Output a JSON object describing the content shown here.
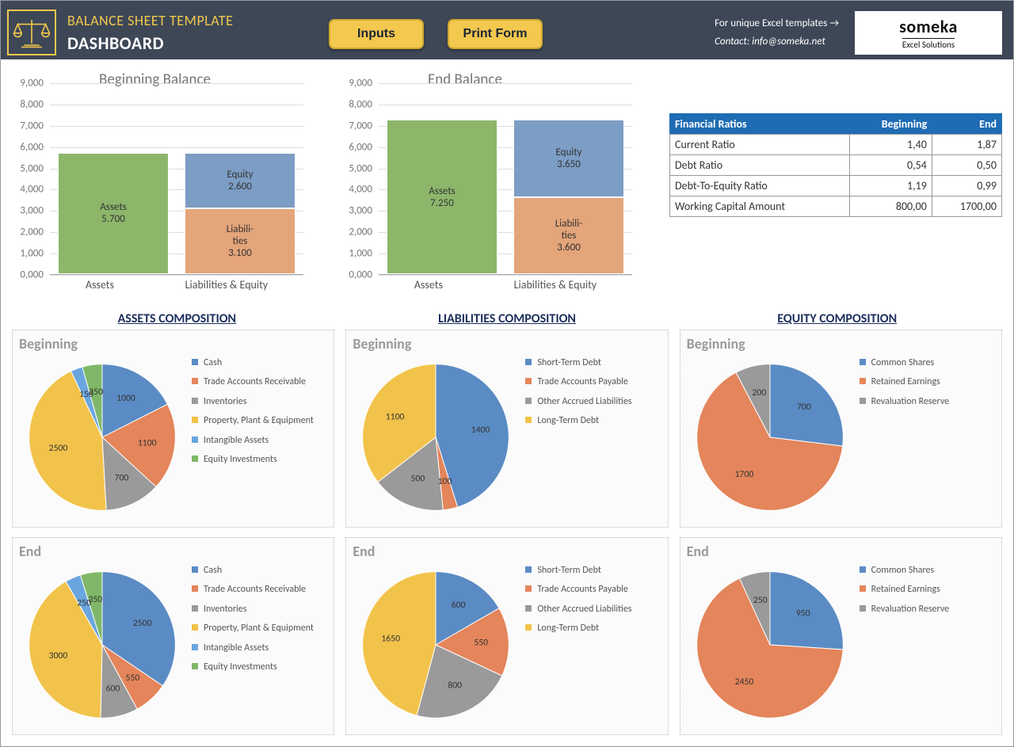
{
  "header": {
    "title": "BALANCE SHEET TEMPLATE",
    "subtitle": "DASHBOARD",
    "btn_inputs": "Inputs",
    "btn_print": "Print Form",
    "link1": "For unique Excel templates →",
    "link2": "Contact: info@someka.net",
    "logo_top": "someka",
    "logo_bottom": "Excel Solutions"
  },
  "barcharts": {
    "beginning_title": "Beginning Balance",
    "end_title": "End Balance",
    "x1": "Assets",
    "x2": "Liabilities & Equity"
  },
  "ratios": {
    "h1": "Financial Ratios",
    "h2": "Beginning",
    "h3": "End",
    "rows": [
      {
        "n": "Current Ratio",
        "b": "1,40",
        "e": "1,87"
      },
      {
        "n": "Debt Ratio",
        "b": "0,54",
        "e": "0,50"
      },
      {
        "n": "Debt-To-Equity Ratio",
        "b": "1,19",
        "e": "0,99"
      },
      {
        "n": "Working Capital Amount",
        "b": "800,00",
        "e": "1700,00"
      }
    ]
  },
  "sections": {
    "assets": "ASSETS COMPOSITION",
    "liab": "LIABILITIES COMPOSITION",
    "equity": "EQUITY COMPOSITION"
  },
  "periods": {
    "beg": "Beginning",
    "end": "End"
  },
  "legends": {
    "assets": [
      "Cash",
      "Trade Accounts Receivable",
      "Inventories",
      "Property, Plant & Equipment",
      "Intangible Assets",
      "Equity Investments"
    ],
    "liab": [
      "Short-Term Debt",
      "Trade Accounts Payable",
      "Other Accrued Liabilities",
      "Long-Term Debt"
    ],
    "equity": [
      "Common Shares",
      "Retained Earnings",
      "Revaluation Reserve"
    ]
  },
  "chart_data": [
    {
      "id": "bar_beginning",
      "type": "bar",
      "title": "Beginning Balance",
      "categories": [
        "Assets",
        "Liabilities & Equity"
      ],
      "series": [
        {
          "name": "Assets",
          "values": [
            5700,
            0
          ]
        },
        {
          "name": "Liabilities",
          "values": [
            0,
            3100
          ]
        },
        {
          "name": "Equity",
          "values": [
            0,
            2600
          ]
        }
      ],
      "ylim": [
        0,
        9000
      ],
      "ytick": 1000
    },
    {
      "id": "bar_end",
      "type": "bar",
      "title": "End Balance",
      "categories": [
        "Assets",
        "Liabilities & Equity"
      ],
      "series": [
        {
          "name": "Assets",
          "values": [
            7250,
            0
          ]
        },
        {
          "name": "Liabilities",
          "values": [
            0,
            3600
          ]
        },
        {
          "name": "Equity",
          "values": [
            0,
            3650
          ]
        }
      ],
      "ylim": [
        0,
        9000
      ],
      "ytick": 1000
    },
    {
      "id": "pie_assets_beg",
      "type": "pie",
      "title": "Assets Composition – Beginning",
      "labels": [
        "Cash",
        "Trade Accounts Receivable",
        "Inventories",
        "Property, Plant & Equipment",
        "Intangible Assets",
        "Equity Investments"
      ],
      "values": [
        1000,
        1100,
        700,
        2500,
        150,
        250
      ]
    },
    {
      "id": "pie_assets_end",
      "type": "pie",
      "title": "Assets Composition – End",
      "labels": [
        "Cash",
        "Trade Accounts Receivable",
        "Inventories",
        "Property, Plant & Equipment",
        "Intangible Assets",
        "Equity Investments"
      ],
      "values": [
        2500,
        550,
        600,
        3000,
        250,
        350
      ]
    },
    {
      "id": "pie_liab_beg",
      "type": "pie",
      "title": "Liabilities Composition – Beginning",
      "labels": [
        "Short-Term Debt",
        "Trade Accounts Payable",
        "Other Accrued Liabilities",
        "Long-Term Debt"
      ],
      "values": [
        1400,
        100,
        500,
        1100
      ]
    },
    {
      "id": "pie_liab_end",
      "type": "pie",
      "title": "Liabilities Composition – End",
      "labels": [
        "Short-Term Debt",
        "Trade Accounts Payable",
        "Other Accrued Liabilities",
        "Long-Term Debt"
      ],
      "values": [
        600,
        550,
        800,
        1650
      ]
    },
    {
      "id": "pie_equity_beg",
      "type": "pie",
      "title": "Equity Composition – Beginning",
      "labels": [
        "Common Shares",
        "Retained Earnings",
        "Revaluation Reserve"
      ],
      "values": [
        700,
        1700,
        200
      ]
    },
    {
      "id": "pie_equity_end",
      "type": "pie",
      "title": "Equity Composition – End",
      "labels": [
        "Common Shares",
        "Retained Earnings",
        "Revaluation Reserve"
      ],
      "values": [
        950,
        2450,
        250
      ]
    }
  ]
}
